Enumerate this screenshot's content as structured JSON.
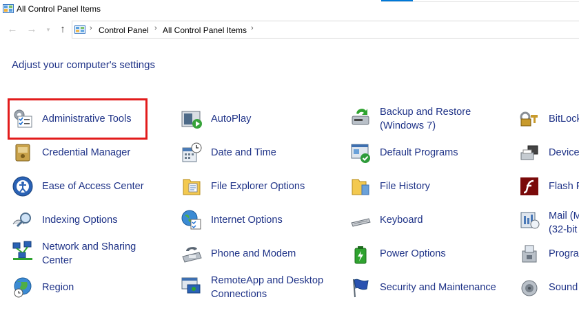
{
  "window": {
    "title": "All Control Panel Items"
  },
  "address": {
    "crumbs": [
      "Control Panel",
      "All Control Panel Items"
    ]
  },
  "heading": "Adjust your computer's settings",
  "items": {
    "administrative_tools": "Administrative Tools",
    "autoplay": "AutoPlay",
    "backup_restore_1": "Backup and Restore",
    "backup_restore_2": "(Windows 7)",
    "bitlocker": "BitLock",
    "credential_manager": "Credential Manager",
    "date_time": "Date and Time",
    "default_programs": "Default Programs",
    "devices": "Device",
    "ease_of_access": "Ease of Access Center",
    "file_explorer_options": "File Explorer Options",
    "file_history": "File History",
    "flash": "Flash P",
    "indexing_options": "Indexing Options",
    "internet_options": "Internet Options",
    "keyboard": "Keyboard",
    "mail_1": "Mail (M",
    "mail_2": "(32-bit",
    "network_1": "Network and Sharing",
    "network_2": "Center",
    "phone_modem": "Phone and Modem",
    "power_options": "Power Options",
    "programs": "Progra",
    "region": "Region",
    "remoteapp_1": "RemoteApp and Desktop",
    "remoteapp_2": "Connections",
    "security_maintenance": "Security and Maintenance",
    "sound": "Sound"
  },
  "colors": {
    "link": "#1e3287",
    "highlight": "#e21b1b",
    "accent": "#0078d7"
  }
}
